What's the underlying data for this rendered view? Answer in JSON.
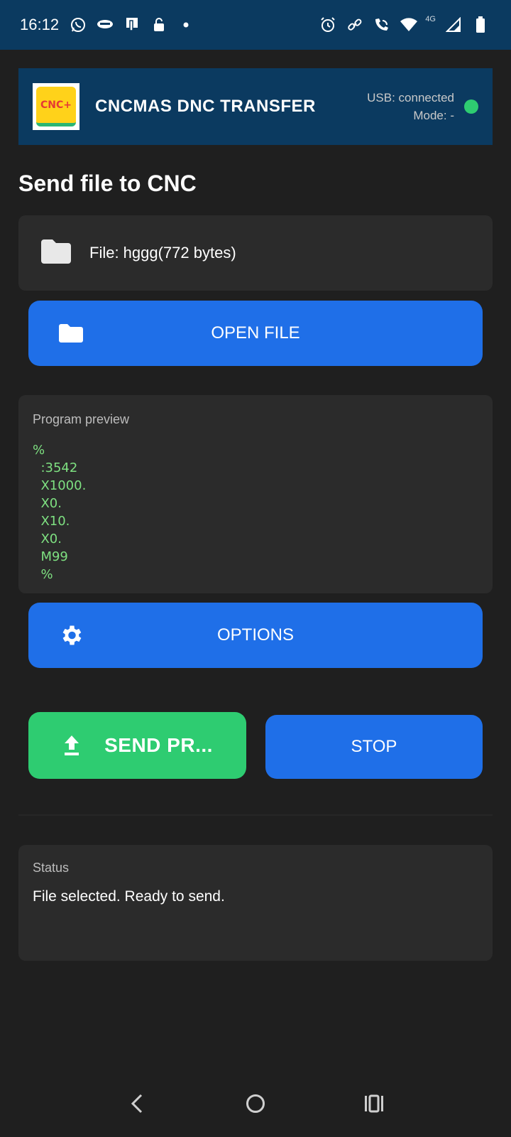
{
  "status_bar": {
    "time": "16:12",
    "network": "4G"
  },
  "app": {
    "title": "CNCMAS DNC TRANSFER",
    "logo_text": "CNC+",
    "usb_status": "USB: connected",
    "mode": "Mode: -",
    "connection_color": "#2ecc71"
  },
  "page": {
    "title": "Send file to CNC"
  },
  "file": {
    "label": "File: hggg(772 bytes)"
  },
  "buttons": {
    "open_file": "OPEN FILE",
    "options": "OPTIONS",
    "send": "SEND PR...",
    "stop": "STOP"
  },
  "preview": {
    "caption": "Program preview",
    "code": "%\n  :3542\n  X1000.\n  X0.\n  X10.\n  X0.\n  M99\n  %"
  },
  "status": {
    "caption": "Status",
    "text": "File selected. Ready to send."
  },
  "colors": {
    "header_bg": "#0b3a60",
    "primary_button": "#1f6fe8",
    "send_button": "#2ecc71",
    "code_text": "#7ee081"
  },
  "icons": {
    "status_left": [
      "whatsapp-icon",
      "chat-icon",
      "sim-icon",
      "lock-icon",
      "dot-icon"
    ],
    "status_right": [
      "alarm-icon",
      "link-icon",
      "call-wifi-icon",
      "wifi-icon",
      "signal-icon",
      "battery-icon"
    ],
    "nav": [
      "back-icon",
      "home-icon",
      "recents-icon"
    ]
  }
}
